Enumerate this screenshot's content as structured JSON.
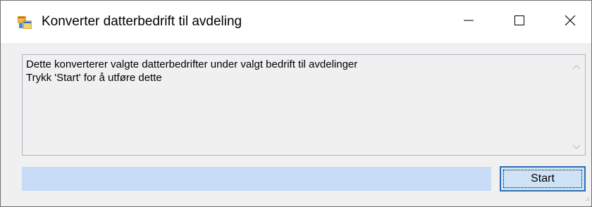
{
  "window": {
    "title": "Konverter datterbedrift til avdeling",
    "icon": "windows-form-icon",
    "controls": {
      "minimize": "minimize-icon",
      "maximize": "maximize-icon",
      "close": "close-icon"
    }
  },
  "main": {
    "message": "Dette konverterer valgte datterbedrifter under valgt bedrift til avdelinger\nTrykk 'Start' for å utføre dette",
    "progress": {
      "value": 0
    },
    "start_label": "Start"
  },
  "colors": {
    "accent": "#2b6fb8",
    "progress_track": "#c8dcf7",
    "window_bg": "#f0f0f0"
  }
}
